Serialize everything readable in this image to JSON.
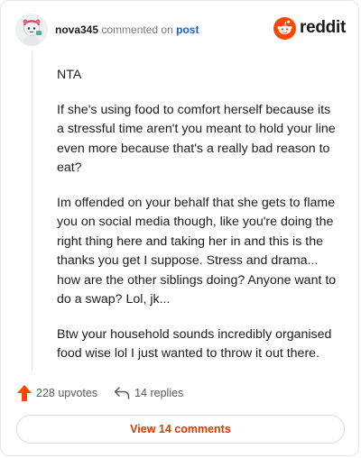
{
  "comment": {
    "username": "nova345",
    "action_text": "commented on",
    "target_link": "post",
    "paragraphs": [
      "NTA",
      "If she's using food to comfort herself because its a stressful time aren't you meant to hold your line even more because that's a really bad reason to eat?",
      "Im offended on your behalf that she gets to flame you on social media though, like you're doing the right thing here and taking her in and this is the thanks you get I suppose. Stress and drama... how are the other siblings doing? Anyone want to do a swap? Lol, jk...",
      "Btw your household sounds incredibly organised food wise lol I just wanted to throw it out there."
    ],
    "upvotes_label": "228 upvotes",
    "replies_label": "14 replies",
    "view_comments_label": "View 14 comments"
  },
  "brand": {
    "wordmark": "reddit",
    "icon": "reddit-snoo-icon",
    "color": "#ff4500"
  },
  "icons": {
    "upvote": "upvote-arrow-icon",
    "reply": "reply-arrow-icon",
    "avatar": "avatar"
  },
  "colors": {
    "upvote": "#ff4500",
    "link": "#1c5fd1",
    "view_comments": "#d93a00"
  }
}
